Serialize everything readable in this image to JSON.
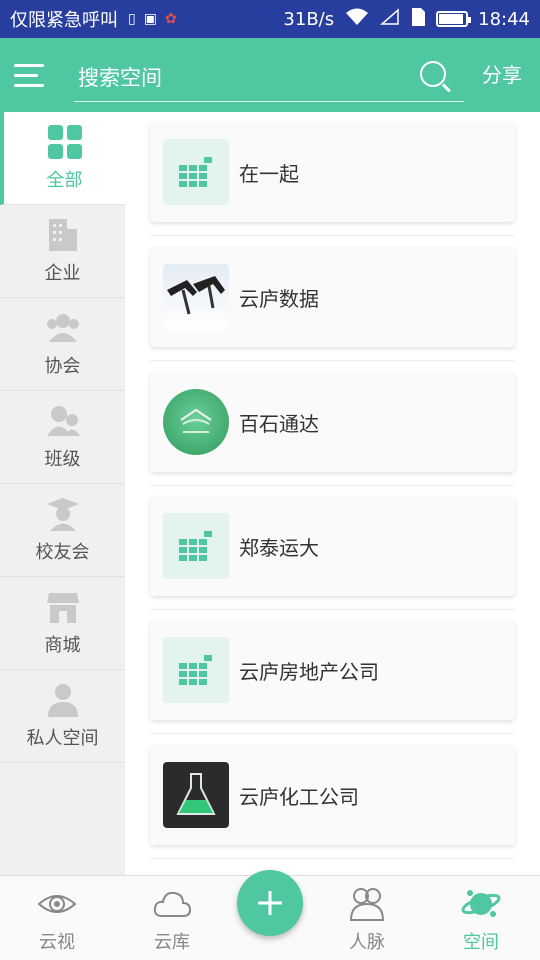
{
  "status_bar": {
    "carrier": "仅限紧急呼叫",
    "net_speed": "31B/s",
    "time": "18:44"
  },
  "header": {
    "search_placeholder": "搜索空间",
    "share_label": "分享"
  },
  "sidebar": {
    "items": [
      {
        "label": "全部",
        "icon": "grid-icon",
        "active": true
      },
      {
        "label": "企业",
        "icon": "building-icon",
        "active": false
      },
      {
        "label": "协会",
        "icon": "group-icon",
        "active": false
      },
      {
        "label": "班级",
        "icon": "class-icon",
        "active": false
      },
      {
        "label": "校友会",
        "icon": "graduate-icon",
        "active": false
      },
      {
        "label": "商城",
        "icon": "shop-icon",
        "active": false
      },
      {
        "label": "私人空间",
        "icon": "person-icon",
        "active": false
      }
    ]
  },
  "spaces": [
    {
      "name": "在一起",
      "thumb": "default-space-icon"
    },
    {
      "name": "云庐数据",
      "thumb": "roof-logo"
    },
    {
      "name": "百石通达",
      "thumb": "green-circle-logo"
    },
    {
      "name": "郑泰运大",
      "thumb": "default-space-icon"
    },
    {
      "name": "云庐房地产公司",
      "thumb": "default-space-icon"
    },
    {
      "name": "云庐化工公司",
      "thumb": "flask-logo"
    }
  ],
  "bottom_nav": {
    "items": [
      {
        "label": "云视",
        "icon": "eye-icon",
        "active": false
      },
      {
        "label": "云库",
        "icon": "cloud-icon",
        "active": false
      },
      {
        "label": "人脉",
        "icon": "contacts-icon",
        "active": false
      },
      {
        "label": "空间",
        "icon": "planet-icon",
        "active": true
      }
    ],
    "fab_icon": "plus-icon"
  },
  "colors": {
    "accent": "#4fc7a0",
    "status_bar": "#283e9e"
  }
}
